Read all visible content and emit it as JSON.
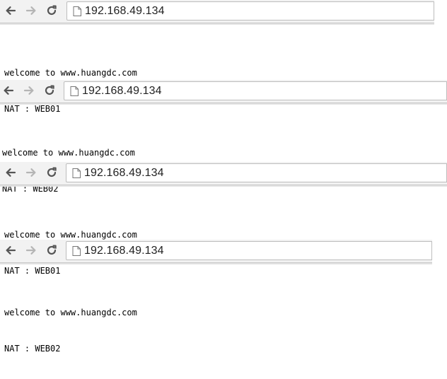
{
  "windows": [
    {
      "url": "192.168.49.134",
      "lines": [
        "welcome to www.huangdc.com",
        "NAT : WEB01"
      ]
    },
    {
      "url": "192.168.49.134",
      "lines": [
        "welcome to www.huangdc.com",
        "NAT : WEB02"
      ]
    },
    {
      "url": "192.168.49.134",
      "lines": [
        "welcome to www.huangdc.com",
        "NAT : WEB01"
      ]
    },
    {
      "url": "192.168.49.134",
      "lines": [
        "welcome to www.huangdc.com",
        "NAT : WEB02"
      ]
    }
  ],
  "icons": {
    "back": "back-arrow-icon",
    "forward": "forward-arrow-icon",
    "reload": "reload-icon",
    "page": "page-icon"
  },
  "colors": {
    "toolbar_bg": "#f2f2f2",
    "icon_active": "#555555",
    "icon_disabled": "#b5b5b5"
  }
}
